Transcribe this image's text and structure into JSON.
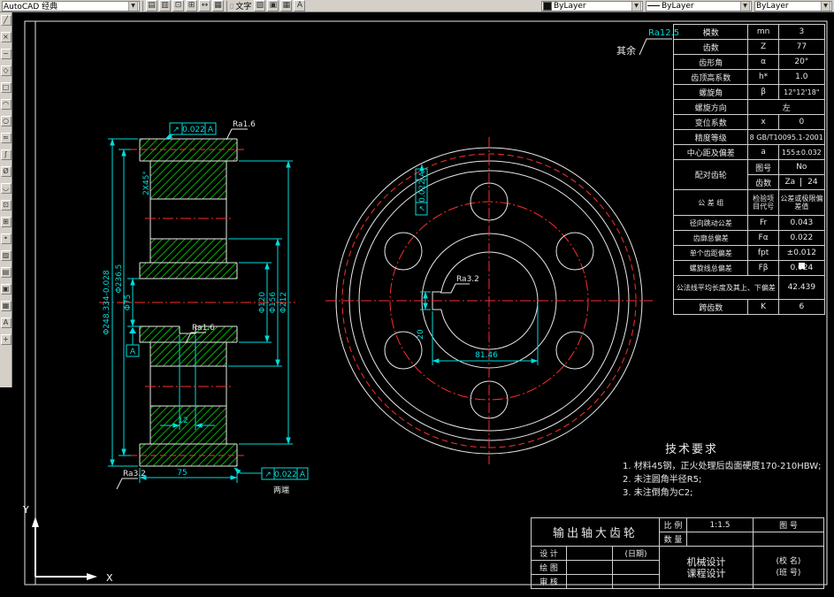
{
  "app": {
    "workspace": "AutoCAD 经典",
    "text_toolbar_label": "文字",
    "color_control": "ByLayer",
    "linetype_control": "ByLayer",
    "lineweight_control": "ByLayer"
  },
  "top_toolbar_icons_a": [
    "sheet-set",
    "markup",
    "block-insert",
    "block-make",
    "dim-style",
    "table-style"
  ],
  "top_toolbar_icons_b": [
    "hatch",
    "region",
    "table",
    "multiline-text"
  ],
  "left_toolbar_icons": [
    "line",
    "construction-line",
    "polyline",
    "polygon",
    "rectangle",
    "arc",
    "circle",
    "revision-cloud",
    "spline",
    "ellipse",
    "ellipse-arc",
    "insert-block",
    "make-block",
    "point",
    "hatch",
    "gradient",
    "region",
    "table",
    "multiline-text",
    "add-selected"
  ],
  "surface_note": {
    "prefix": "其余",
    "value": "Ra12.5"
  },
  "gear_table": {
    "r1": {
      "label": "模数",
      "sym": "mn",
      "val": "3"
    },
    "r2": {
      "label": "齿数",
      "sym": "Z",
      "val": "77"
    },
    "r3": {
      "label": "齿形角",
      "sym": "α",
      "val": "20°"
    },
    "r4": {
      "label": "齿顶高系数",
      "sym": "h*",
      "val": "1.0"
    },
    "r5": {
      "label": "螺旋角",
      "sym": "β",
      "val": "12°12'18\""
    },
    "r6": {
      "label": "螺旋方向",
      "val": "左"
    },
    "r7": {
      "label": "变位系数",
      "sym": "x",
      "val": "0"
    },
    "r8": {
      "label": "精度等级",
      "val": "8 GB/T10095.1-2001"
    },
    "r9": {
      "label": "中心距及偏差",
      "sym": "a",
      "val": "155±0.032"
    },
    "r10": {
      "label": "配对齿轮",
      "sub1": "图号",
      "val1": "No",
      "sub2": "齿数",
      "sym2": "Za",
      "val2": "24"
    },
    "hdr": {
      "c1": "公 差 组",
      "c2": "检验项目代号",
      "c3": "公差或极限偏差值"
    },
    "r11": {
      "label": "径向跳动公差",
      "sym": "Fr",
      "val": "0.043"
    },
    "r12": {
      "label": "齿廓总偏差",
      "sym": "Fα",
      "val": "0.022"
    },
    "r13": {
      "label": "单个齿距偏差",
      "sym": "fpt",
      "val": "±0.012"
    },
    "r14": {
      "label": "螺旋线总偏差",
      "sym": "Fβ",
      "val": "0.024"
    },
    "r15": {
      "label": "公法线平均长度及其上、下偏差",
      "val": "42.439"
    },
    "r16": {
      "label": "跨齿数",
      "sym": "K",
      "val": "6"
    }
  },
  "tech_req": {
    "title": "技术要求",
    "items": [
      "1. 材料45钢，正火处理后齿面硬度170-210HBW;",
      "2. 未注圆角半径R5;",
      "3. 未注倒角为C2;"
    ]
  },
  "title_block": {
    "part_name": "输出轴大齿轮",
    "scale_label": "比 例",
    "scale_val": "1:1.5",
    "fig_no_label": "图 号",
    "qty_label": "数 量",
    "design_label": "设 计",
    "date_label": "(日期)",
    "draw_label": "绘 图",
    "check_label": "审 核",
    "org_line1": "机械设计",
    "org_line2": "课程设计",
    "school": "(校 名)",
    "class_no": "(班 号)"
  },
  "dims": {
    "od": "Φ248.334-0.028",
    "pitch_d": "Φ236.5",
    "bore": "Φ75",
    "hub_d": "Φ120",
    "web_d": "Φ156",
    "rim_d": "Φ212",
    "width": "75",
    "key_w": "12",
    "chamfer": "2X45°",
    "key_width_front": "20",
    "key_depth_front": "81.46",
    "runout_symbol": "↗",
    "runout_top": "0.022",
    "datum_top": "A",
    "runout_bottom": "0.022",
    "datum_bottom": "A",
    "both_ends": "两端",
    "runout_front": "0.022",
    "datum_front": "A",
    "ra16": "Ra1.6",
    "ra32": "Ra3.2"
  },
  "ucs": {
    "x": "X",
    "y": "Y"
  },
  "colors": {
    "dimension": "#00dcdc",
    "centerline": "#ff2d2d",
    "hatch": "#00b400",
    "geometry": "#e8e8e8",
    "toolbar_bg": "#d4d0c8"
  }
}
